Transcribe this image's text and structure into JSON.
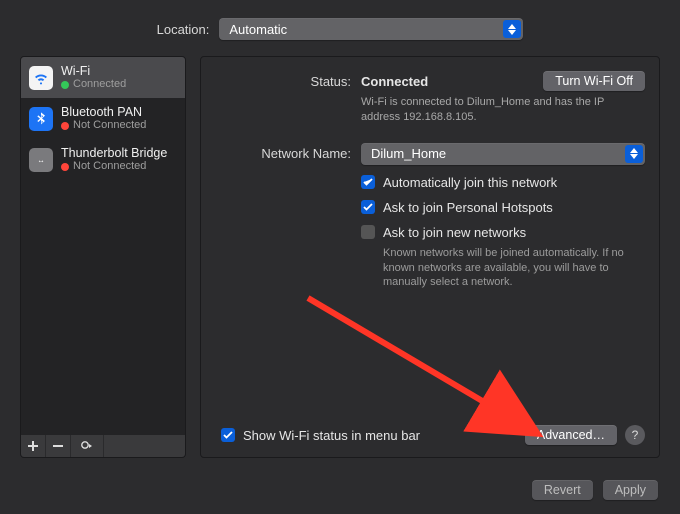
{
  "location": {
    "label": "Location:",
    "value": "Automatic"
  },
  "sidebar": {
    "items": [
      {
        "name": "Wi-Fi",
        "status": "Connected",
        "dot": "green"
      },
      {
        "name": "Bluetooth PAN",
        "status": "Not Connected",
        "dot": "red"
      },
      {
        "name": "Thunderbolt Bridge",
        "status": "Not Connected",
        "dot": "red"
      }
    ]
  },
  "status": {
    "label": "Status:",
    "value": "Connected",
    "toggle_label": "Turn Wi-Fi Off",
    "desc": "Wi-Fi is connected to Dilum_Home and has the IP address 192.168.8.105."
  },
  "network": {
    "label": "Network Name:",
    "value": "Dilum_Home"
  },
  "checks": {
    "auto_join": "Automatically join this network",
    "hotspots": "Ask to join Personal Hotspots",
    "ask_new": "Ask to join new networks",
    "ask_new_help": "Known networks will be joined automatically. If no known networks are available, you will have to manually select a network."
  },
  "menubar": "Show Wi-Fi status in menu bar",
  "advanced": "Advanced…",
  "help": "?",
  "footer": {
    "revert": "Revert",
    "apply": "Apply"
  }
}
